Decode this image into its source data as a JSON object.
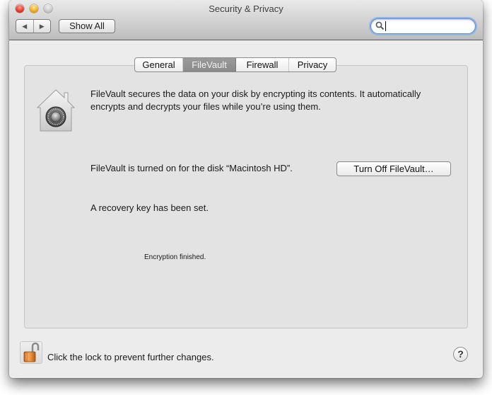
{
  "window": {
    "title": "Security & Privacy"
  },
  "toolbar": {
    "back_icon": "◀",
    "forward_icon": "▶",
    "show_all_label": "Show All",
    "search": {
      "value": "",
      "placeholder": ""
    }
  },
  "tabs": [
    {
      "label": "General",
      "selected": false
    },
    {
      "label": "FileVault",
      "selected": true
    },
    {
      "label": "Firewall",
      "selected": false
    },
    {
      "label": "Privacy",
      "selected": false
    }
  ],
  "filevault": {
    "icon": "filevault-house-safe-icon",
    "description": "FileVault secures the data on your disk by encrypting its contents. It automatically encrypts and decrypts your files while you’re using them.",
    "status_text": "FileVault is turned on for the disk “Macintosh HD”.",
    "turn_off_button_label": "Turn Off FileVault…",
    "recovery_text": "A recovery key has been set.",
    "encryption_status": "Encryption finished."
  },
  "footer": {
    "lock_icon": "unlocked-padlock-icon",
    "lock_text": "Click the lock to prevent further changes.",
    "help_label": "?"
  }
}
